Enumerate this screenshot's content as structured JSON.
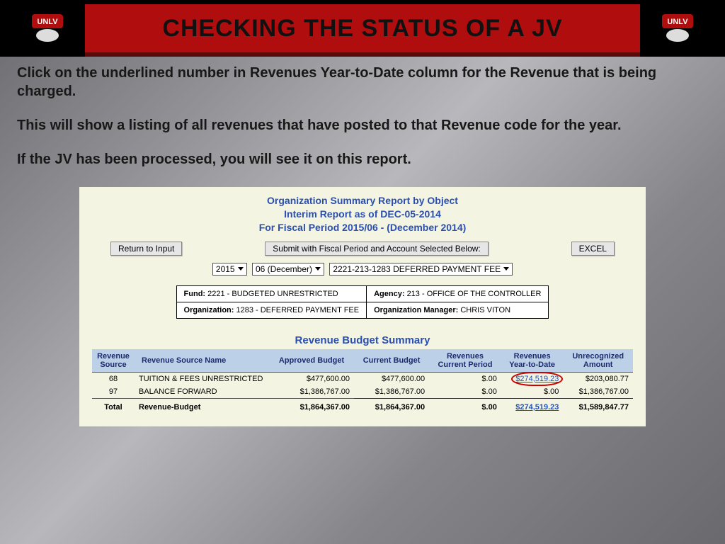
{
  "header": {
    "title": "CHECKING THE STATUS OF A JV",
    "logo_alt": "UNLV"
  },
  "instructions": {
    "p1": "Click on the underlined number in Revenues Year-to-Date column for the Revenue that is being charged.",
    "p2": "This will show a listing of all revenues that have posted to that Revenue code for the year.",
    "p3": "If the JV has been processed, you will see it on this report."
  },
  "report": {
    "title_l1": "Organization Summary Report by Object",
    "title_l2": "Interim Report as of DEC-05-2014",
    "title_l3": "For Fiscal Period 2015/06 - (December  2014)",
    "buttons": {
      "return": "Return to Input",
      "submit": "Submit with Fiscal Period and Account Selected Below:",
      "excel": "EXCEL"
    },
    "selects": {
      "year": "2015",
      "period": "06  (December)",
      "account": "2221-213-1283  DEFERRED PAYMENT FEE"
    },
    "info": {
      "fund_label": "Fund:",
      "fund_value": "2221 - BUDGETED UNRESTRICTED",
      "agency_label": "Agency:",
      "agency_value": "213 - OFFICE OF THE CONTROLLER",
      "org_label": "Organization:",
      "org_value": "1283 - DEFERRED PAYMENT FEE",
      "mgr_label": "Organization Manager:",
      "mgr_value": "CHRIS VITON"
    },
    "section_title": "Revenue Budget Summary",
    "columns": {
      "c1a": "Revenue",
      "c1b": "Source",
      "c2": "Revenue Source Name",
      "c3": "Approved Budget",
      "c4": "Current Budget",
      "c5a": "Revenues",
      "c5b": "Current Period",
      "c6a": "Revenues",
      "c6b": "Year-to-Date",
      "c7a": "Unrecognized",
      "c7b": "Amount"
    },
    "rows": [
      {
        "src": "68",
        "name": "TUITION & FEES UNRESTRICTED",
        "approved": "$477,600.00",
        "current": "$477,600.00",
        "cur_period": "$.00",
        "ytd": "$274,519.23",
        "ytd_link": true,
        "ytd_circled": true,
        "unrec": "$203,080.77"
      },
      {
        "src": "97",
        "name": "BALANCE FORWARD",
        "approved": "$1,386,767.00",
        "current": "$1,386,767.00",
        "cur_period": "$.00",
        "ytd": "$.00",
        "ytd_link": false,
        "ytd_circled": false,
        "unrec": "$1,386,767.00"
      }
    ],
    "total": {
      "label": "Total",
      "name": "Revenue-Budget",
      "approved": "$1,864,367.00",
      "current": "$1,864,367.00",
      "cur_period": "$.00",
      "ytd": "$274,519.23",
      "unrec": "$1,589,847.77"
    }
  }
}
